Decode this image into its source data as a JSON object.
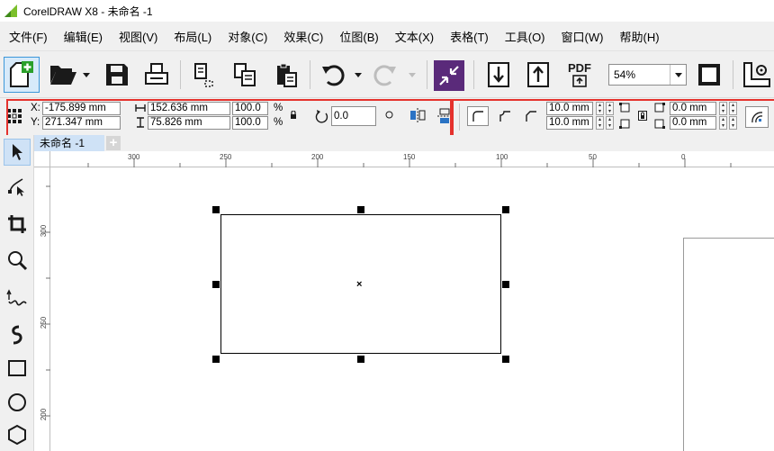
{
  "window": {
    "title": "CorelDRAW X8 - 未命名 -1"
  },
  "menu": [
    {
      "label": "文件",
      "accel": "(F)"
    },
    {
      "label": "编辑",
      "accel": "(E)"
    },
    {
      "label": "视图",
      "accel": "(V)"
    },
    {
      "label": "布局",
      "accel": "(L)"
    },
    {
      "label": "对象",
      "accel": "(C)"
    },
    {
      "label": "效果",
      "accel": "(C)"
    },
    {
      "label": "位图",
      "accel": "(B)"
    },
    {
      "label": "文本",
      "accel": "(X)"
    },
    {
      "label": "表格",
      "accel": "(T)"
    },
    {
      "label": "工具",
      "accel": "(O)"
    },
    {
      "label": "窗口",
      "accel": "(W)"
    },
    {
      "label": "帮助",
      "accel": "(H)"
    }
  ],
  "toolbar": {
    "zoom_value": "54%",
    "pdf_label": "PDF"
  },
  "properties": {
    "x_label": "X:",
    "x_value": "-175.899 mm",
    "y_label": "Y:",
    "y_value": "271.347 mm",
    "width_value": "152.636 mm",
    "height_value": "75.826 mm",
    "scale_w": "100.0",
    "scale_h": "100.0",
    "pct1": "%",
    "pct2": "%",
    "rotation_value": "0.0",
    "corner_tl": "10.0 mm",
    "corner_bl": "10.0 mm",
    "corner_tr": "0.0 mm",
    "corner_br": "0.0 mm"
  },
  "document_tab": {
    "label": "未命名 -1",
    "add_label": "+"
  },
  "ruler": {
    "h_labels": [
      "300",
      "250",
      "200",
      "150",
      "100",
      "50",
      "0"
    ],
    "v_labels": [
      "300",
      "250",
      "200"
    ]
  },
  "colors": {
    "highlight": "#e5322d",
    "tab_bg": "#cfe2f6",
    "panel": "#f0f0f0"
  }
}
